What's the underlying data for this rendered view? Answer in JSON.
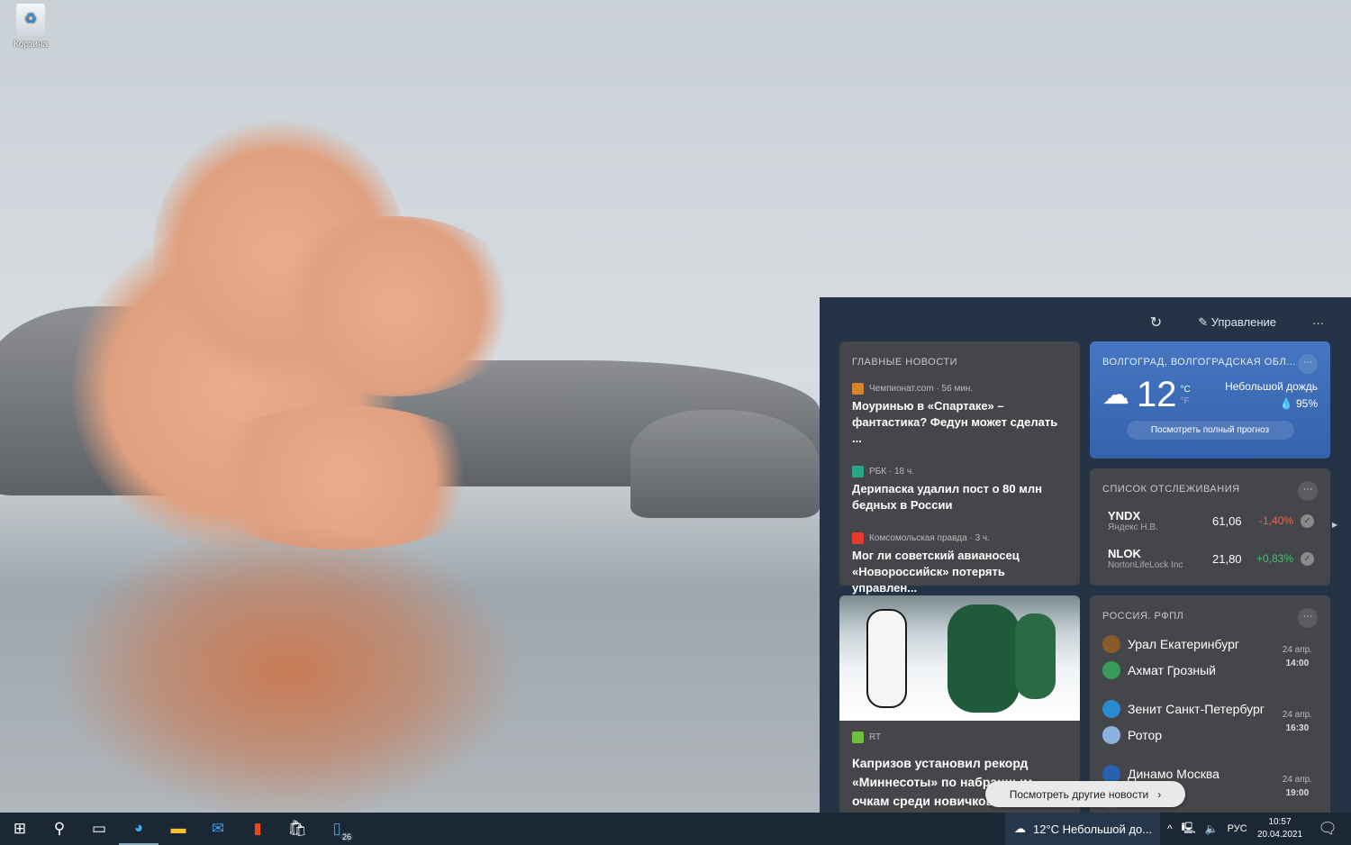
{
  "desktop": {
    "recycle_bin_label": "Корзина"
  },
  "panel": {
    "manage_label": "Управление",
    "refresh_icon": "refresh-icon",
    "more_icon": "ellipsis-icon"
  },
  "top_news": {
    "title": "ГЛАВНЫЕ НОВОСТИ",
    "items": [
      {
        "source": "Чемпионат.com · 56 мин.",
        "headline": "Моуринью в «Спартаке» – фантастика? Федун может сделать ...",
        "color": "#d9822b"
      },
      {
        "source": "РБК · 18 ч.",
        "headline": "Дерипаска удалил пост о 80 млн бедных в России",
        "color": "#2aa58a"
      },
      {
        "source": "Комсомольская правда · 3 ч.",
        "headline": "Мог ли советский авианосец «Новороссийск» потерять управлен...",
        "color": "#e53b2c"
      }
    ]
  },
  "weather": {
    "location": "ВОЛГОГРАД, ВОЛГОГРАДСКАЯ ОБЛ...",
    "temp": "12",
    "unit_c": "°C",
    "unit_f": "°F",
    "condition": "Небольшой дождь",
    "precip": "95%",
    "forecast_button": "Посмотреть полный прогноз",
    "accent": "#3a6cb6"
  },
  "watchlist": {
    "title": "СПИСОК ОТСЛЕЖИВАНИЯ",
    "stocks": [
      {
        "ticker": "YNDX",
        "name": "Яндекс Н.В.",
        "price": "61,06",
        "change": "-1,40%",
        "color": "#f0644f"
      },
      {
        "ticker": "NLOK",
        "name": "NortonLifeLock Inc",
        "price": "21,80",
        "change": "+0,83%",
        "color": "#3ec46d"
      }
    ]
  },
  "photo_news": {
    "source": "RT",
    "headline": "Капризов установил рекорд «Миннесоты» по набранным очкам среди новичков"
  },
  "football": {
    "title": "РОССИЯ. РФПЛ",
    "matches": [
      {
        "home": "Урал Екатеринбург",
        "away": "Ахмат Грозный",
        "date": "24 апр.",
        "time": "14:00"
      },
      {
        "home": "Зенит Санкт-Петербург",
        "away": "Ротор",
        "date": "24 апр.",
        "time": "16:30"
      },
      {
        "home": "Динамо Москва",
        "away": "",
        "date": "24 апр.",
        "time": "19:00"
      }
    ]
  },
  "more_news_button": "Посмотреть другие новости",
  "taskbar": {
    "weather": "12°C  Небольшой до...",
    "lang": "РУС",
    "time": "10:57",
    "date": "20.04.2021",
    "badge": "26"
  }
}
